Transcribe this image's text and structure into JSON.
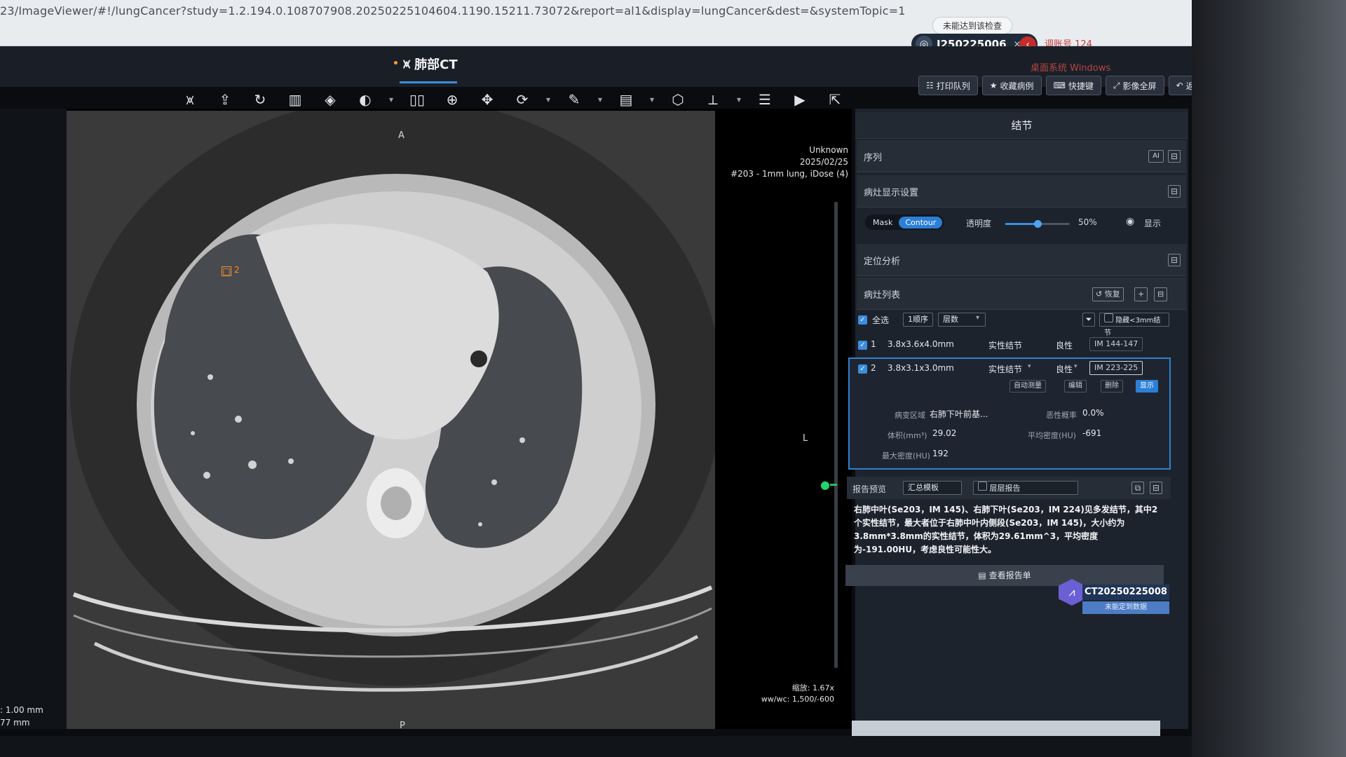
{
  "browser": {
    "url": "23/ImageViewer/#!/lungCancer?study=1.2.194.0.108707908.20250225104604.1190.15211.73072&report=al1&display=lungCancer&dest=&systemTopic=1",
    "status_pill": "未能达到该检查",
    "user_id": "J250225006",
    "user_close": "×",
    "account_label": "调账号 124",
    "system_label": "桌面系统 Windows"
  },
  "app": {
    "tab_title": "肺部CT"
  },
  "toolbar": {
    "tools": [
      "lung-icon",
      "upload-icon",
      "refresh-icon",
      "layout-icon",
      "layers-icon",
      "contrast-icon",
      "split-icon",
      "zoom-icon",
      "pan-icon",
      "rotate-icon",
      "measure-icon",
      "annotation-icon",
      "3d-cube-icon",
      "axis-icon",
      "stack-icon",
      "play-icon",
      "export-icon"
    ],
    "actions": [
      {
        "label": "打印队列",
        "icon": "☷"
      },
      {
        "label": "收藏病例",
        "icon": "★"
      },
      {
        "label": "快捷键",
        "icon": "⌨"
      },
      {
        "label": "影像全屏",
        "icon": "⤢"
      },
      {
        "label": "返回",
        "icon": "↶"
      }
    ]
  },
  "viewer": {
    "orient_top": "A",
    "orient_bottom": "P",
    "orient_right": "L",
    "info_top_right": [
      "Unknown",
      "2025/02/25",
      "#203 - 1mm lung, iDose (4)"
    ],
    "zoom": "缩放: 1.67x",
    "wwwc": "ww/wc: 1,500/-600",
    "thickness_lines": [
      ": 1.00 mm",
      "77 mm"
    ],
    "nodule_tag": "2"
  },
  "panel": {
    "title": "结节",
    "sections": {
      "series": "序列",
      "display": "病灶显示设置",
      "locate": "定位分析",
      "list": "病灶列表"
    },
    "ai_badge": "AI",
    "display_settings": {
      "mode_mask": "Mask",
      "mode_contour": "Contour",
      "opacity_label": "透明度",
      "opacity_value": "50%",
      "opacity_fraction": 0.5,
      "show_label": "显示"
    },
    "list": {
      "restore": "恢复",
      "select_all": "全选",
      "sort_order": "1顺序",
      "sort_field": "层数",
      "hide_small": "隐藏<3mm结节",
      "rows": [
        {
          "idx": "1",
          "size": "3.8x3.6x4.0mm",
          "type": "实性结节",
          "nature": "良性",
          "im": "IM 144-147"
        },
        {
          "idx": "2",
          "size": "3.8x3.1x3.0mm",
          "type": "实性结节",
          "nature": "良性",
          "im": "IM 223-225"
        }
      ],
      "row_actions": [
        "自动测量",
        "编辑",
        "删除",
        "显示"
      ],
      "detail": {
        "location_label": "病变区域",
        "location_value": "右肺下叶前基...",
        "malignancy_label": "恶性概率",
        "malignancy_value": "0.0%",
        "volume_label": "体积(mm³)",
        "volume_value": "29.02",
        "mean_density_label": "平均密度(HU)",
        "mean_density_value": "-691",
        "max_density_label": "最大密度(HU)",
        "max_density_value": "192"
      }
    },
    "report": {
      "label": "报告预览",
      "template": "汇总模板",
      "layered": "层层报告",
      "text": "右肺中叶(Se203，IM 145)、右肺下叶(Se203，IM 224)见多发结节，其中2个实性结节，最大者位于右肺中叶内侧段(Se203，IM 145)，大小约为3.8mm*3.8mm的实性结节，体积为29.61mm^3，平均密度为-191.00HU，考虑良性可能性大。",
      "view_button": "查看报告单"
    },
    "case": {
      "id": "CT20250225008",
      "sub": "未能定到数据"
    }
  },
  "colors": {
    "accent": "#2b7fd6",
    "nodule": "#ff8c2e",
    "slice_marker": "#23d36b"
  }
}
